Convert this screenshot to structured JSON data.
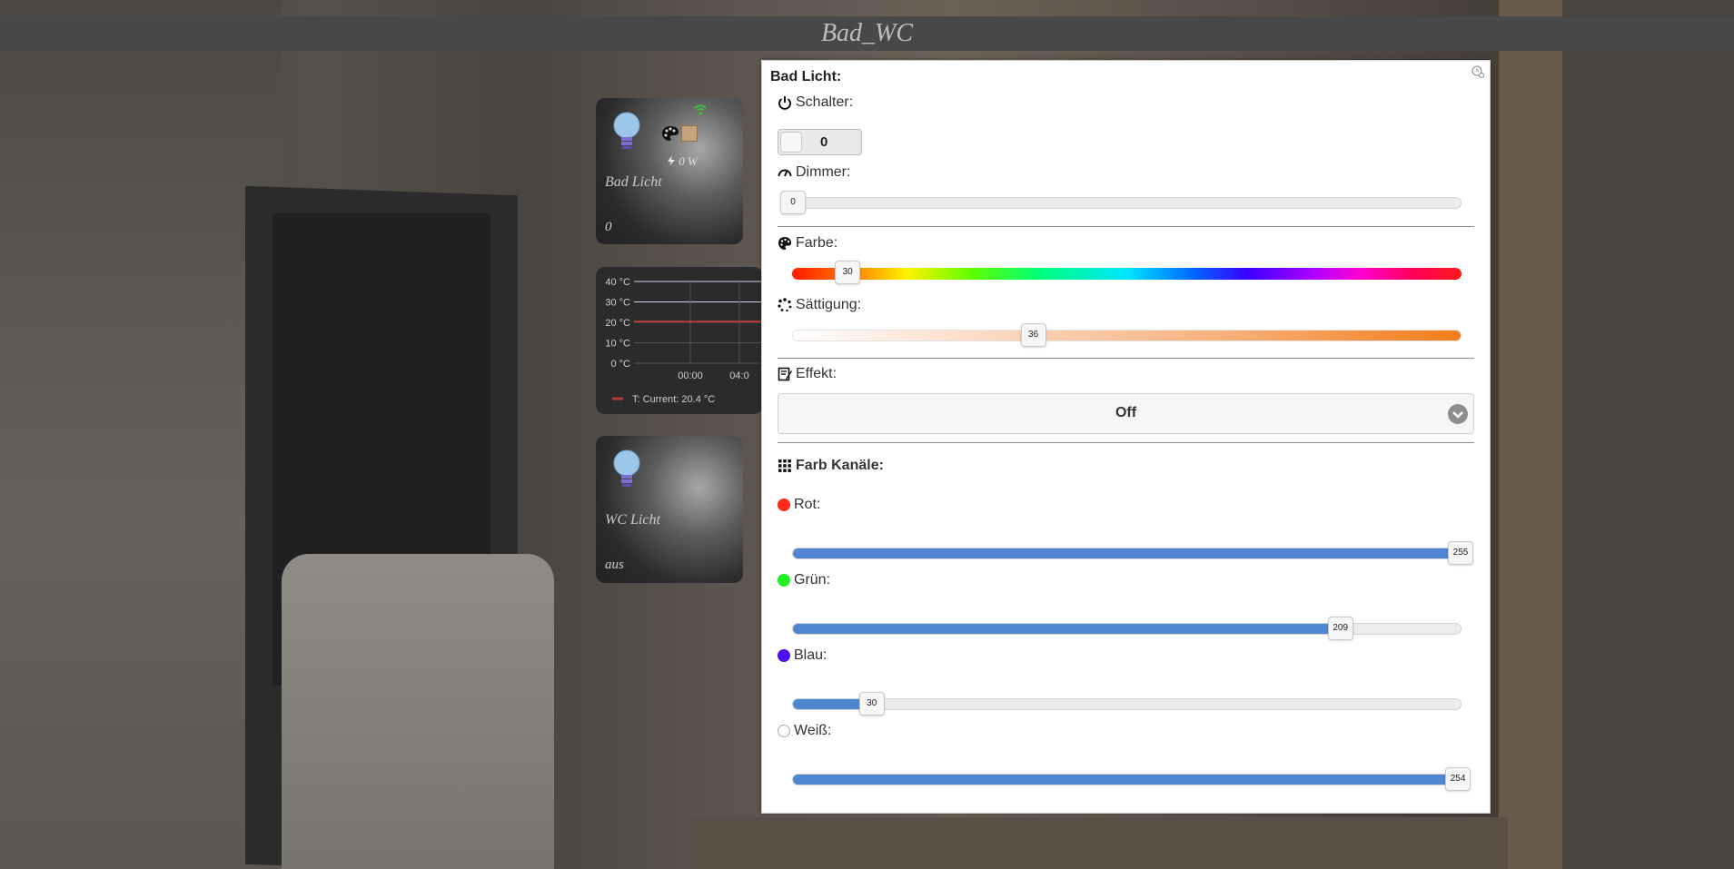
{
  "header": {
    "title": "Bad_WC"
  },
  "tiles": {
    "bad_licht": {
      "name": "Bad Licht",
      "state": "0",
      "power": "0 W"
    },
    "wc_licht": {
      "name": "WC Licht",
      "state": "aus"
    }
  },
  "temp_chart": {
    "legend": "T:  Current: 20.4 °C",
    "current": 20.4
  },
  "chart_data": {
    "type": "line",
    "title": "",
    "xlabel": "",
    "ylabel": "",
    "x_ticks": [
      "00:00",
      "04:0"
    ],
    "y_ticks": [
      "40 °C",
      "30 °C",
      "20 °C",
      "10 °C",
      "0 °C"
    ],
    "ylim": [
      0,
      40
    ],
    "series": [
      {
        "name": "T",
        "values": [
          20.4,
          20.4,
          20.4,
          20.4
        ]
      }
    ],
    "legend_position": "bottom-left",
    "grid": true
  },
  "panel": {
    "title": "Bad Licht:",
    "schalter": {
      "label": "Schalter:",
      "value": "0"
    },
    "dimmer": {
      "label": "Dimmer:",
      "value": "0",
      "fraction": 0.0
    },
    "farbe": {
      "label": "Farbe:",
      "value": "30",
      "fraction": 0.083
    },
    "saettigung": {
      "label": "Sättigung:",
      "value": "36",
      "fraction": 0.36
    },
    "effekt": {
      "label": "Effekt:",
      "value": "Off"
    },
    "farb_kanaele": {
      "label": "Farb Kanäle:"
    },
    "channels": [
      {
        "label": "Rot:",
        "value": "255",
        "fraction": 1.0,
        "color": "#ff2a1a"
      },
      {
        "label": "Grün:",
        "value": "209",
        "fraction": 0.82,
        "color": "#22ee22"
      },
      {
        "label": "Blau:",
        "value": "30",
        "fraction": 0.118,
        "color": "#4a12ee"
      },
      {
        "label": "Weiß:",
        "value": "254",
        "fraction": 0.996,
        "color": "#ffffff"
      }
    ]
  },
  "colors": {
    "slider_fill": "#4f86d2",
    "topbar": "#484848"
  }
}
